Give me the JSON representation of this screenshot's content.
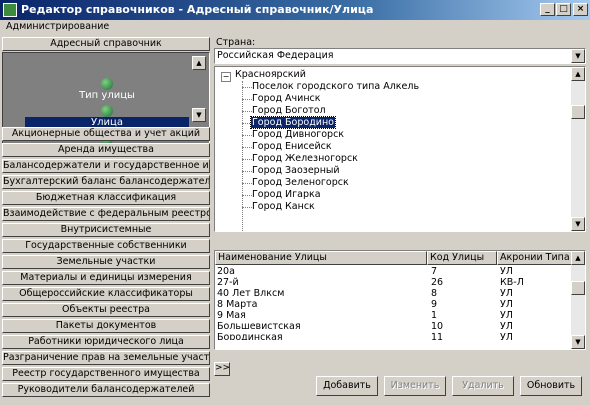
{
  "window": {
    "title": "Редактор справочников - Адресный справочник/Улица",
    "buttons": {
      "minimize": "_",
      "maximize": "□",
      "close": "×"
    }
  },
  "menu": {
    "items": [
      "Администрирование"
    ]
  },
  "sidebar": {
    "header": "Адресный справочник",
    "panel_items": [
      {
        "label": "Тип улицы",
        "icon": "globe-icon",
        "selected": false
      },
      {
        "label": "Улица",
        "icon": "globe-icon",
        "selected": true
      }
    ],
    "categories": [
      "Акционерные общества и учет акций",
      "Аренда имущества",
      "Балансодержатели и государственное иму...",
      "Бухгалтерский баланс балансодержателя",
      "Бюджетная классификация",
      "Взаимодействие с федеральным реестром",
      "Внутрисистемные",
      "Государственные собственники",
      "Земельные участки",
      "Материалы и единицы измерения",
      "Общероссийские классификаторы",
      "Объекты реестра",
      "Пакеты документов",
      "Работники юридического лица",
      "Разграничение прав на земельные участки",
      "Реестр государственного имущества",
      "Руководители балансодержателей"
    ]
  },
  "country": {
    "label": "Страна:",
    "value": "Российская Федерация"
  },
  "tree": {
    "root": "Красноярский",
    "expander": "−",
    "children": [
      {
        "label": "Поселок городского типа Алкель",
        "selected": false
      },
      {
        "label": "Город Ачинск",
        "selected": false
      },
      {
        "label": "Город Боготол",
        "selected": false
      },
      {
        "label": "Город Бородино",
        "selected": true
      },
      {
        "label": "Город Дивногорск",
        "selected": false
      },
      {
        "label": "Город Енисейск",
        "selected": false
      },
      {
        "label": "Город Железногорск",
        "selected": false
      },
      {
        "label": "Город Заозерный",
        "selected": false
      },
      {
        "label": "Город Зеленогорск",
        "selected": false
      },
      {
        "label": "Город Игарка",
        "selected": false
      },
      {
        "label": "Город Канск",
        "selected": false
      }
    ]
  },
  "grid": {
    "columns": [
      "Наименование Улицы",
      "Код Улицы",
      "Акронии Типа У"
    ],
    "rows": [
      [
        "20а",
        "7",
        "УЛ"
      ],
      [
        "27-й",
        "26",
        "КВ-Л"
      ],
      [
        "40 Лет Влксм",
        "8",
        "УЛ"
      ],
      [
        "8 Марта",
        "9",
        "УЛ"
      ],
      [
        "9 Мая",
        "1",
        "УЛ"
      ],
      [
        "Большевистская",
        "10",
        "УЛ"
      ],
      [
        "Бородинская",
        "11",
        "УЛ"
      ]
    ]
  },
  "nav": {
    "label": ">>"
  },
  "actions": [
    {
      "label": "Добавить",
      "enabled": true
    },
    {
      "label": "Изменить",
      "enabled": false
    },
    {
      "label": "Удалить",
      "enabled": false
    },
    {
      "label": "Обновить",
      "enabled": true
    }
  ]
}
